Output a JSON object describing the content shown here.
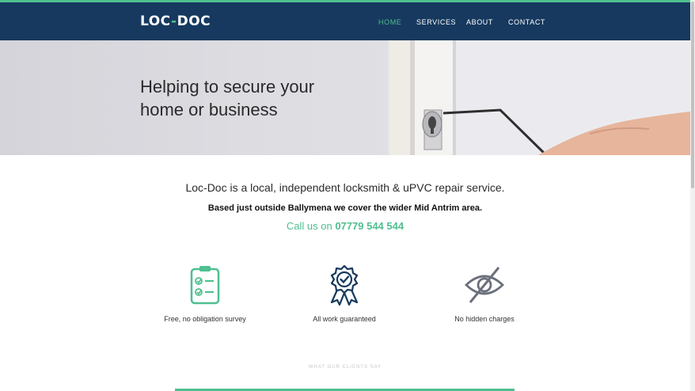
{
  "header": {
    "logo_left": "LOC",
    "logo_dash": "-",
    "logo_right": "DOC",
    "nav": [
      "HOME",
      "SERVICES",
      "ABOUT",
      "CONTACT"
    ]
  },
  "hero": {
    "line1": "Helping to secure your",
    "line2": "home or business"
  },
  "intro": {
    "line1": "Loc-Doc is a local, independent locksmith & uPVC repair service.",
    "line2": "Based just outside Ballymena we cover the wider Mid Antrim area.",
    "call_prefix": "Call us on",
    "phone": "07779 544 544"
  },
  "features": [
    {
      "label": "Free, no obligation survey",
      "icon": "clipboard-check-icon"
    },
    {
      "label": "All work guaranteed",
      "icon": "award-badge-icon"
    },
    {
      "label": "No hidden charges",
      "icon": "eye-slash-icon"
    }
  ],
  "clients_heading": "WHAT OUR CLIENTS SAY",
  "colors": {
    "navy": "#17395f",
    "green": "#4fbf8f"
  }
}
